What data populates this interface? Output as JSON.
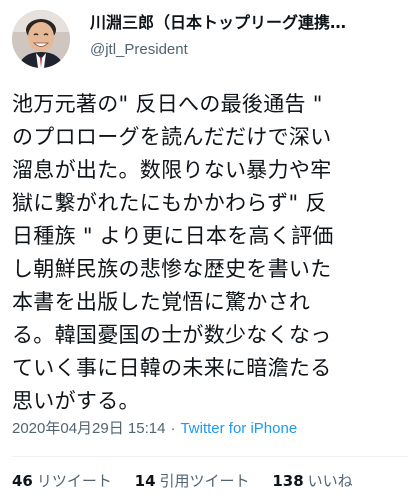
{
  "author": {
    "display_name": "川淵三郎（日本トップリーグ連携…",
    "handle": "@jtl_President"
  },
  "tweet": {
    "lines": [
      "池万元著の\" 反日への最後通告 \"",
      "のプロローグを読んだだけで深い",
      "溜息が出た。数限りない暴力や牢",
      "獄に繋がれたにもかかわらず\" 反",
      "日種族 \" より更に日本を高く評価",
      "し朝鮮民族の悲惨な歴史を書いた",
      "本書を出版した覚悟に驚かされ",
      "る。韓国憂国の士が数少なくなっ",
      "ていく事に日韓の未来に暗澹たる",
      "思いがする。"
    ],
    "timestamp": "2020年04月29日 15:14",
    "separator": "·",
    "source": "Twitter for iPhone"
  },
  "stats": {
    "retweets_count": "46",
    "retweets_label": "リツイート",
    "quotes_count": "14",
    "quotes_label": "引用ツイート",
    "likes_count": "138",
    "likes_label": "いいね"
  },
  "colors": {
    "text": "#0f1419",
    "secondary": "#536471",
    "link": "#1d9bf0",
    "divider": "#eff3f4"
  }
}
